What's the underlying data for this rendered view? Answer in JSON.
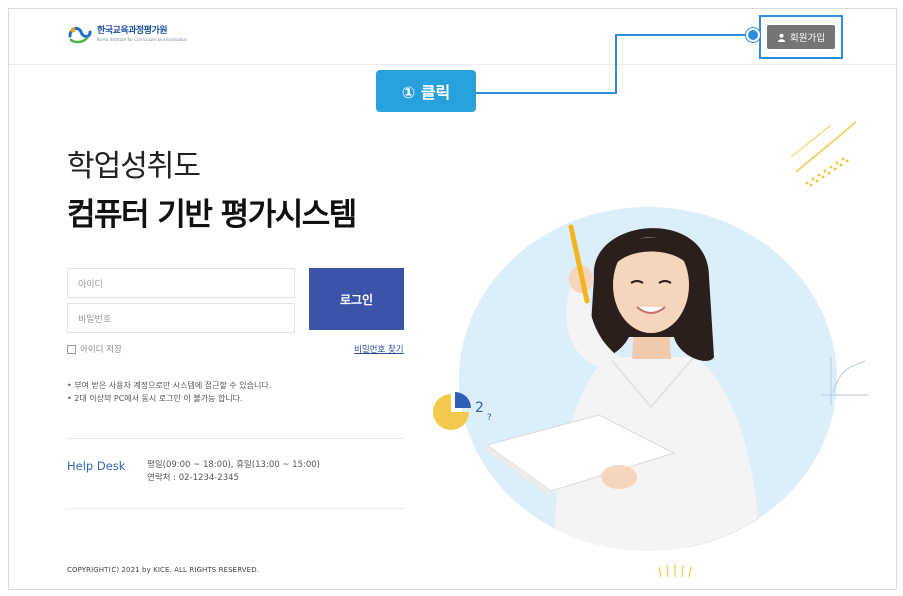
{
  "header": {
    "logo_ko": "한국교육과정평가원",
    "logo_en": "Korea Institute for Curriculum and Evaluation",
    "signup_label": "회원가입",
    "signup_icon": "user-icon"
  },
  "callout": {
    "label": "① 클릭",
    "color": "#28a0dc"
  },
  "hero": {
    "line1": "학업성취도",
    "line2": "컴퓨터 기반 평가시스템"
  },
  "login": {
    "id_placeholder": "아이디",
    "pw_placeholder": "비밀번호",
    "login_button": "로그인",
    "remember_label": "아이디 저장",
    "find_password": "비밀번호 찾기"
  },
  "notices": [
    "• 부여 받은 사용자 계정으로만 시스템에 접근할 수 있습니다.",
    "• 2대 이상의 PC에서 동시 로그인 이 불가능 합니다."
  ],
  "helpdesk": {
    "label": "Help Desk",
    "hours": "평일(09:00 ~ 18:00), 휴일(13:00 ~ 15:00)",
    "contact": "연락처 : 02-1234-2345"
  },
  "footer": {
    "copyright": "COPYRIGHT(C) 2021 by KICE. ALL RIGHTS RESERVED."
  },
  "colors": {
    "primary": "#3c54a8",
    "accent": "#2f8de0",
    "signup_bg": "#757575",
    "circle_bg": "#dceefa"
  }
}
